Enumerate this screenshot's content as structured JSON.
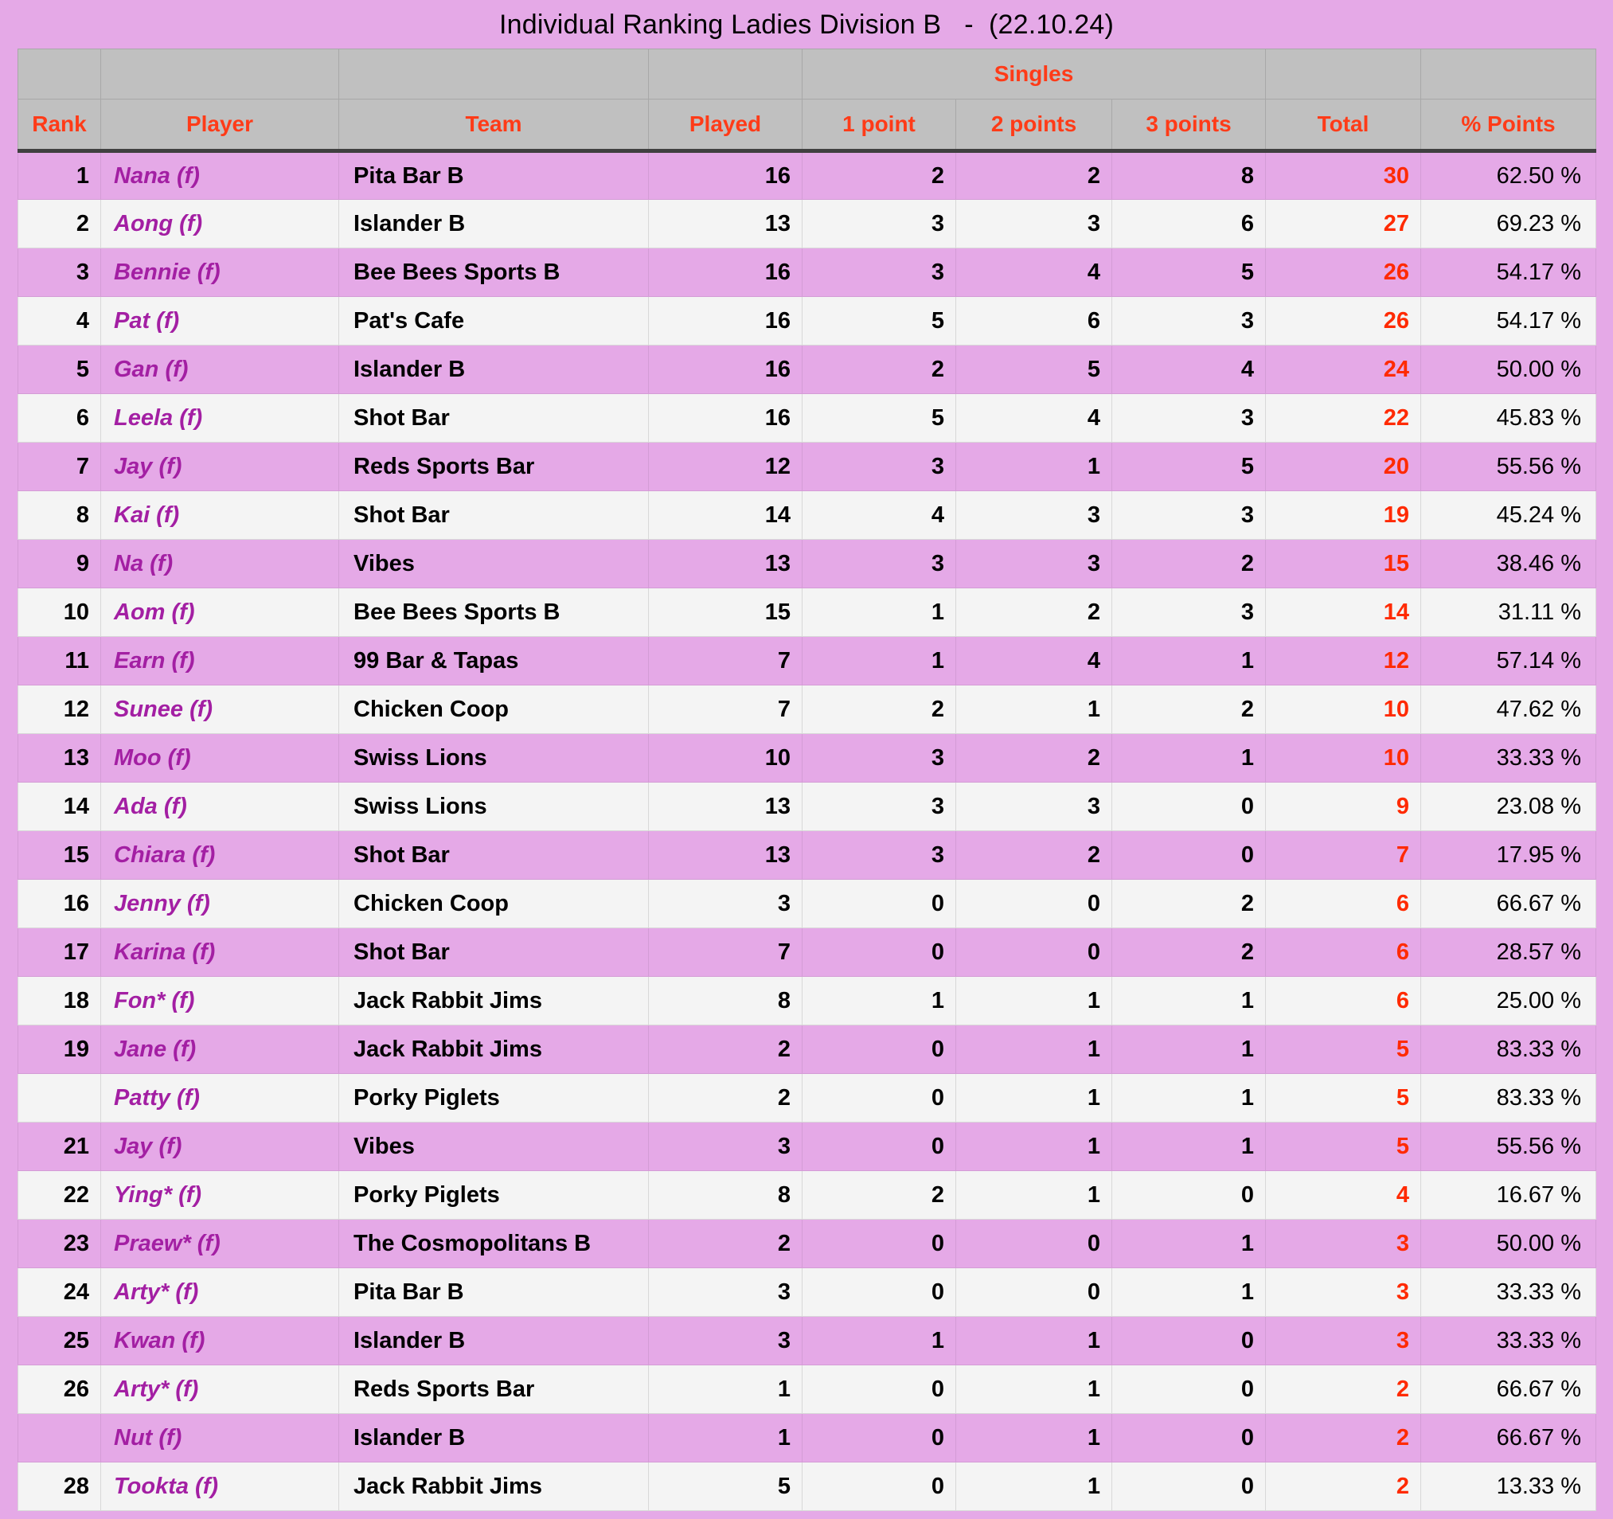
{
  "page": {
    "title": "Individual Ranking Ladies Division B   -  (22.10.24)",
    "background_color": "#e5a9e7",
    "accent_color": "#ff3b18",
    "player_name_color": "#a31fa3",
    "total_color": "#ff2a00",
    "header_background": "#c0c0c0"
  },
  "table": {
    "group_headers": {
      "blank_rank": "",
      "blank_player": "",
      "blank_team": "",
      "blank_played": "",
      "singles": "Singles",
      "blank_total": "",
      "blank_pct": ""
    },
    "columns": [
      {
        "key": "rank",
        "label": "Rank"
      },
      {
        "key": "player",
        "label": "Player"
      },
      {
        "key": "team",
        "label": "Team"
      },
      {
        "key": "played",
        "label": "Played"
      },
      {
        "key": "p1",
        "label": "1 point"
      },
      {
        "key": "p2",
        "label": "2 points"
      },
      {
        "key": "p3",
        "label": "3 points"
      },
      {
        "key": "total",
        "label": "Total"
      },
      {
        "key": "pct",
        "label": "% Points"
      }
    ],
    "rows": [
      {
        "rank": "1",
        "player": "Nana (f)",
        "team": "Pita Bar B",
        "played": "16",
        "p1": "2",
        "p2": "2",
        "p3": "8",
        "total": "30",
        "pct": "62.50 %"
      },
      {
        "rank": "2",
        "player": "Aong (f)",
        "team": "Islander B",
        "played": "13",
        "p1": "3",
        "p2": "3",
        "p3": "6",
        "total": "27",
        "pct": "69.23 %"
      },
      {
        "rank": "3",
        "player": "Bennie (f)",
        "team": "Bee Bees Sports B",
        "played": "16",
        "p1": "3",
        "p2": "4",
        "p3": "5",
        "total": "26",
        "pct": "54.17 %"
      },
      {
        "rank": "4",
        "player": "Pat (f)",
        "team": "Pat's Cafe",
        "played": "16",
        "p1": "5",
        "p2": "6",
        "p3": "3",
        "total": "26",
        "pct": "54.17 %"
      },
      {
        "rank": "5",
        "player": "Gan (f)",
        "team": "Islander B",
        "played": "16",
        "p1": "2",
        "p2": "5",
        "p3": "4",
        "total": "24",
        "pct": "50.00 %"
      },
      {
        "rank": "6",
        "player": "Leela (f)",
        "team": "Shot Bar",
        "played": "16",
        "p1": "5",
        "p2": "4",
        "p3": "3",
        "total": "22",
        "pct": "45.83 %"
      },
      {
        "rank": "7",
        "player": "Jay (f)",
        "team": "Reds Sports Bar",
        "played": "12",
        "p1": "3",
        "p2": "1",
        "p3": "5",
        "total": "20",
        "pct": "55.56 %"
      },
      {
        "rank": "8",
        "player": "Kai (f)",
        "team": "Shot Bar",
        "played": "14",
        "p1": "4",
        "p2": "3",
        "p3": "3",
        "total": "19",
        "pct": "45.24 %"
      },
      {
        "rank": "9",
        "player": "Na (f)",
        "team": "Vibes",
        "played": "13",
        "p1": "3",
        "p2": "3",
        "p3": "2",
        "total": "15",
        "pct": "38.46 %"
      },
      {
        "rank": "10",
        "player": "Aom (f)",
        "team": "Bee Bees Sports B",
        "played": "15",
        "p1": "1",
        "p2": "2",
        "p3": "3",
        "total": "14",
        "pct": "31.11 %"
      },
      {
        "rank": "11",
        "player": "Earn (f)",
        "team": "99 Bar & Tapas",
        "played": "7",
        "p1": "1",
        "p2": "4",
        "p3": "1",
        "total": "12",
        "pct": "57.14 %"
      },
      {
        "rank": "12",
        "player": "Sunee (f)",
        "team": "Chicken Coop",
        "played": "7",
        "p1": "2",
        "p2": "1",
        "p3": "2",
        "total": "10",
        "pct": "47.62 %"
      },
      {
        "rank": "13",
        "player": "Moo (f)",
        "team": "Swiss Lions",
        "played": "10",
        "p1": "3",
        "p2": "2",
        "p3": "1",
        "total": "10",
        "pct": "33.33 %"
      },
      {
        "rank": "14",
        "player": "Ada (f)",
        "team": "Swiss Lions",
        "played": "13",
        "p1": "3",
        "p2": "3",
        "p3": "0",
        "total": "9",
        "pct": "23.08 %"
      },
      {
        "rank": "15",
        "player": "Chiara (f)",
        "team": "Shot Bar",
        "played": "13",
        "p1": "3",
        "p2": "2",
        "p3": "0",
        "total": "7",
        "pct": "17.95 %"
      },
      {
        "rank": "16",
        "player": "Jenny (f)",
        "team": "Chicken Coop",
        "played": "3",
        "p1": "0",
        "p2": "0",
        "p3": "2",
        "total": "6",
        "pct": "66.67 %"
      },
      {
        "rank": "17",
        "player": "Karina (f)",
        "team": "Shot Bar",
        "played": "7",
        "p1": "0",
        "p2": "0",
        "p3": "2",
        "total": "6",
        "pct": "28.57 %"
      },
      {
        "rank": "18",
        "player": "Fon* (f)",
        "team": "Jack Rabbit Jims",
        "played": "8",
        "p1": "1",
        "p2": "1",
        "p3": "1",
        "total": "6",
        "pct": "25.00 %"
      },
      {
        "rank": "19",
        "player": "Jane (f)",
        "team": "Jack Rabbit Jims",
        "played": "2",
        "p1": "0",
        "p2": "1",
        "p3": "1",
        "total": "5",
        "pct": "83.33 %"
      },
      {
        "rank": "",
        "player": "Patty (f)",
        "team": "Porky Piglets",
        "played": "2",
        "p1": "0",
        "p2": "1",
        "p3": "1",
        "total": "5",
        "pct": "83.33 %"
      },
      {
        "rank": "21",
        "player": "Jay (f)",
        "team": "Vibes",
        "played": "3",
        "p1": "0",
        "p2": "1",
        "p3": "1",
        "total": "5",
        "pct": "55.56 %"
      },
      {
        "rank": "22",
        "player": "Ying* (f)",
        "team": "Porky Piglets",
        "played": "8",
        "p1": "2",
        "p2": "1",
        "p3": "0",
        "total": "4",
        "pct": "16.67 %"
      },
      {
        "rank": "23",
        "player": "Praew* (f)",
        "team": "The Cosmopolitans B",
        "played": "2",
        "p1": "0",
        "p2": "0",
        "p3": "1",
        "total": "3",
        "pct": "50.00 %"
      },
      {
        "rank": "24",
        "player": "Arty* (f)",
        "team": "Pita Bar B",
        "played": "3",
        "p1": "0",
        "p2": "0",
        "p3": "1",
        "total": "3",
        "pct": "33.33 %"
      },
      {
        "rank": "25",
        "player": "Kwan (f)",
        "team": "Islander B",
        "played": "3",
        "p1": "1",
        "p2": "1",
        "p3": "0",
        "total": "3",
        "pct": "33.33 %"
      },
      {
        "rank": "26",
        "player": "Arty* (f)",
        "team": "Reds Sports Bar",
        "played": "1",
        "p1": "0",
        "p2": "1",
        "p3": "0",
        "total": "2",
        "pct": "66.67 %"
      },
      {
        "rank": "",
        "player": "Nut (f)",
        "team": "Islander B",
        "played": "1",
        "p1": "0",
        "p2": "1",
        "p3": "0",
        "total": "2",
        "pct": "66.67 %"
      },
      {
        "rank": "28",
        "player": "Tookta (f)",
        "team": "Jack Rabbit Jims",
        "played": "5",
        "p1": "0",
        "p2": "1",
        "p3": "0",
        "total": "2",
        "pct": "13.33 %"
      }
    ]
  }
}
